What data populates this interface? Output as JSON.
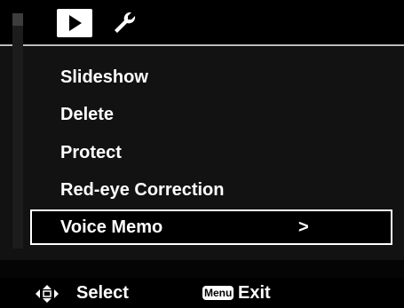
{
  "tabs": [
    {
      "name": "playback",
      "icon": "play-icon",
      "active": true
    },
    {
      "name": "setup",
      "icon": "wrench-icon",
      "active": false
    }
  ],
  "menu": {
    "items": [
      {
        "label": "Slideshow"
      },
      {
        "label": "Delete"
      },
      {
        "label": "Protect"
      },
      {
        "label": "Red-eye Correction"
      },
      {
        "label": "Voice Memo",
        "selected": true,
        "submenu_arrow": ">"
      }
    ]
  },
  "footer": {
    "select_icon": "dpad-icon",
    "select_label": "Select",
    "menu_badge": "Menu",
    "exit_label": "Exit"
  },
  "colors": {
    "background": "#000000",
    "text": "#ffffff",
    "highlight_border": "#ffffff",
    "divider": "#bdbdbd"
  }
}
